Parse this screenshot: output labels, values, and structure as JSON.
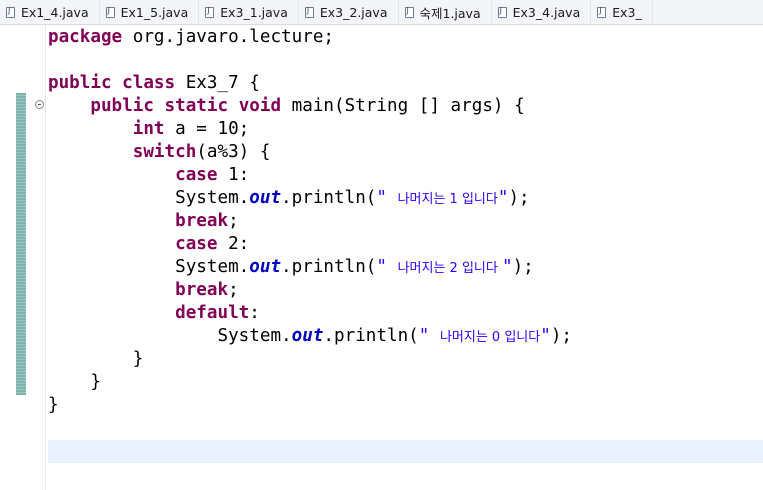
{
  "tabs": [
    {
      "label": "Ex1_4.java",
      "icon": "java-file-icon"
    },
    {
      "label": "Ex1_5.java",
      "icon": "java-file-icon"
    },
    {
      "label": "Ex3_1.java",
      "icon": "java-file-icon"
    },
    {
      "label": "Ex3_2.java",
      "icon": "java-file-icon"
    },
    {
      "label": "숙제1.java",
      "icon": "java-file-icon"
    },
    {
      "label": "Ex3_4.java",
      "icon": "java-file-icon"
    },
    {
      "label": "Ex3_",
      "icon": "java-file-icon"
    }
  ],
  "code": {
    "l1": {
      "kw": "package",
      "rest": " org.javaro.lecture;"
    },
    "l3": {
      "kw1": "public",
      "kw2": "class",
      "rest": " Ex3_7 {"
    },
    "l4": {
      "indent": "    ",
      "kw1": "public",
      "kw2": "static",
      "kw3": "void",
      "rest": " main(String [] args) {"
    },
    "l5": {
      "indent": "        ",
      "kw": "int",
      "rest": " a = 10;"
    },
    "l6": {
      "indent": "        ",
      "kw": "switch",
      "rest": "(a%3) {"
    },
    "l7": {
      "indent": "            ",
      "kw": "case",
      "rest": " 1:"
    },
    "l8": {
      "indent": "            ",
      "pre": "System.",
      "field": "out",
      "mid": ".println(",
      "q1": "\" ",
      "str": "나머지는 1 입니다",
      "q2": "\"",
      "end": ");"
    },
    "l9": {
      "indent": "            ",
      "kw": "break",
      "rest": ";"
    },
    "l10": {
      "indent": "            ",
      "kw": "case",
      "rest": " 2:"
    },
    "l11": {
      "indent": "            ",
      "pre": "System.",
      "field": "out",
      "mid": ".println(",
      "q1": "\" ",
      "str": "나머지는 2 입니다 ",
      "q2": "\"",
      "end": ");"
    },
    "l12": {
      "indent": "            ",
      "kw": "break",
      "rest": ";"
    },
    "l13": {
      "indent": "            ",
      "kw": "default",
      "rest": ":"
    },
    "l14": {
      "indent": "                ",
      "pre": "System.",
      "field": "out",
      "mid": ".println(",
      "q1": "\" ",
      "str": "나머지는 0 입니다",
      "q2": "\"",
      "end": ");"
    },
    "l15": {
      "indent": "        ",
      "rest": "}"
    },
    "l16": {
      "indent": "    ",
      "rest": "}"
    },
    "l17": {
      "indent": "",
      "rest": "}"
    }
  },
  "colors": {
    "keyword": "#7f0055",
    "field": "#0000c0",
    "string": "#2a00ff",
    "current_line": "#e8f2fe",
    "change_bar": "#7fb3ad"
  }
}
